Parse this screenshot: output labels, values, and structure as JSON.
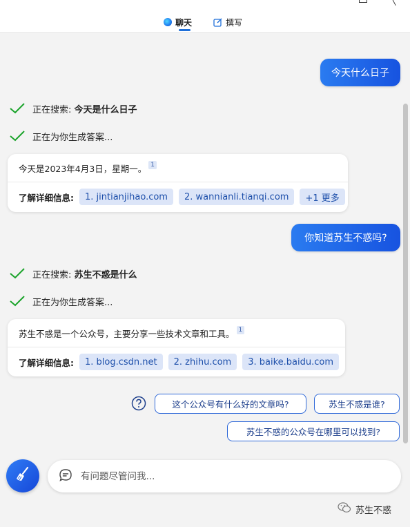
{
  "header": {
    "tabs": [
      {
        "label": "聊天",
        "icon": "chat-bubble-icon",
        "active": true
      },
      {
        "label": "撰写",
        "icon": "compose-icon",
        "active": false
      }
    ]
  },
  "conversation": {
    "turns": [
      {
        "user_message": "今天什么日子",
        "status_items": [
          {
            "prefix": "正在搜索: ",
            "query": "今天是什么日子"
          },
          {
            "prefix": "正在为你生成答案...",
            "query": ""
          }
        ],
        "answer": {
          "text": "今天是2023年4月3日，星期一。",
          "citation": "1",
          "links_label": "了解详细信息:",
          "links": [
            "1. jintianjihao.com",
            "2. wannianli.tianqi.com",
            "+1 更多"
          ]
        }
      },
      {
        "user_message": "你知道苏生不惑吗?",
        "status_items": [
          {
            "prefix": "正在搜索: ",
            "query": "苏生不惑是什么"
          },
          {
            "prefix": "正在为你生成答案...",
            "query": ""
          }
        ],
        "answer": {
          "text": "苏生不惑是一个公众号，主要分享一些技术文章和工具。",
          "citation": "1",
          "links_label": "了解详细信息:",
          "links": [
            "1. blog.csdn.net",
            "2. zhihu.com",
            "3. baike.baidu.com"
          ]
        }
      }
    ]
  },
  "suggestions": {
    "icon": "help-question-icon",
    "items": [
      "这个公众号有什么好的文章吗?",
      "苏生不惑是谁?",
      "苏生不惑的公众号在哪里可以找到?"
    ]
  },
  "composer": {
    "new_topic_icon": "broom-icon",
    "placeholder": "有问题尽管问我..."
  },
  "watermark": {
    "icon": "wechat-icon",
    "text": "苏生不惑"
  },
  "colors": {
    "accent": "#1e6fd9",
    "user_bubble": "#1f63e6",
    "check_green": "#1aa32a",
    "link_chip": "#dce5f8"
  }
}
